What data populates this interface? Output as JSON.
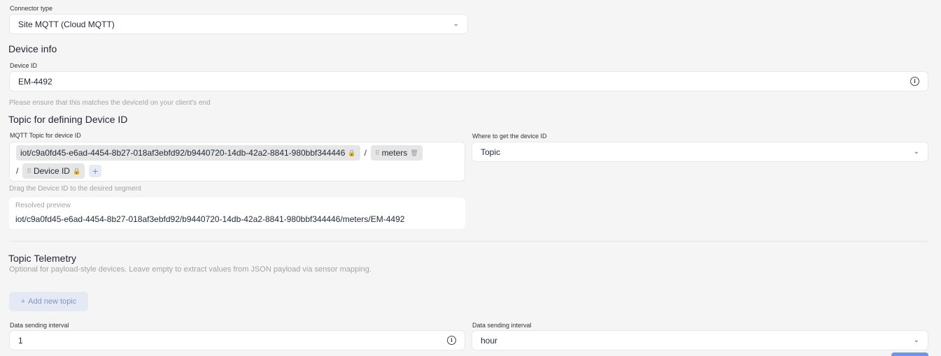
{
  "connector": {
    "label": "Connector type",
    "value": "Site MQTT (Cloud MQTT)"
  },
  "device_info": {
    "title": "Device info",
    "device_id_label": "Device ID",
    "device_id_value": "EM-4492",
    "hint": "Please ensure that this matches the deviceId on your client's end"
  },
  "topic_defining": {
    "title": "Topic for defining Device ID",
    "mqtt_label": "MQTT Topic for device ID",
    "segments": {
      "seg1": "iot/c9a0fd45-e6ad-4454-8b27-018af3ebfd92/b9440720-14db-42a2-8841-980bbf344446",
      "seg2": "meters",
      "seg3": "Device ID",
      "separator": "/"
    },
    "drag_hint": "Drag the Device ID to the desired segment",
    "preview_label": "Resolved preview",
    "preview_value": "iot/c9a0fd45-e6ad-4454-8b27-018af3ebfd92/b9440720-14db-42a2-8841-980bbf344446/meters/EM-4492",
    "where_label": "Where to get the device ID",
    "where_value": "Topic"
  },
  "telemetry": {
    "title": "Topic Telemetry",
    "description": "Optional for payload-style devices. Leave empty to extract values from JSON payload via sensor mapping.",
    "add_label": "Add new topic"
  },
  "interval": {
    "label_left": "Data sending interval",
    "value_left": "1",
    "label_right": "Data sending interval",
    "value_right": "hour"
  },
  "icons": {
    "chevron": "chevron-down-icon",
    "info": "info-icon",
    "lock": "lock-icon",
    "grip": "drag-grip-icon",
    "trash": "trash-icon",
    "plus": "plus-icon"
  }
}
